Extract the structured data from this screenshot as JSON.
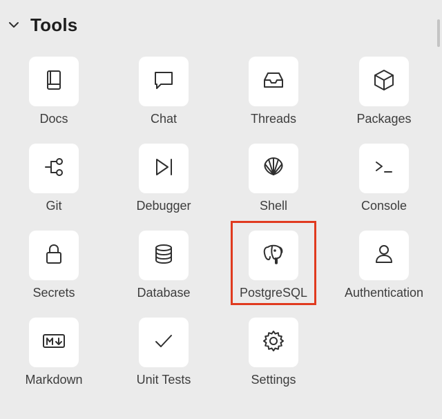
{
  "section": {
    "title": "Tools",
    "expanded": true
  },
  "tools": [
    {
      "label": "Docs",
      "icon": "book-icon"
    },
    {
      "label": "Chat",
      "icon": "chat-bubble-icon"
    },
    {
      "label": "Threads",
      "icon": "inbox-tray-icon"
    },
    {
      "label": "Packages",
      "icon": "package-cube-icon"
    },
    {
      "label": "Git",
      "icon": "git-branch-icon"
    },
    {
      "label": "Debugger",
      "icon": "step-play-icon"
    },
    {
      "label": "Shell",
      "icon": "seashell-icon"
    },
    {
      "label": "Console",
      "icon": "terminal-prompt-icon"
    },
    {
      "label": "Secrets",
      "icon": "lock-icon"
    },
    {
      "label": "Database",
      "icon": "database-icon"
    },
    {
      "label": "PostgreSQL",
      "icon": "elephant-icon",
      "highlighted": true
    },
    {
      "label": "Authentication",
      "icon": "user-icon"
    },
    {
      "label": "Markdown",
      "icon": "markdown-icon"
    },
    {
      "label": "Unit Tests",
      "icon": "checkmark-icon"
    },
    {
      "label": "Settings",
      "icon": "gear-icon"
    }
  ],
  "colors": {
    "background": "#ebebeb",
    "tile": "#ffffff",
    "highlight": "#e03a1f"
  }
}
